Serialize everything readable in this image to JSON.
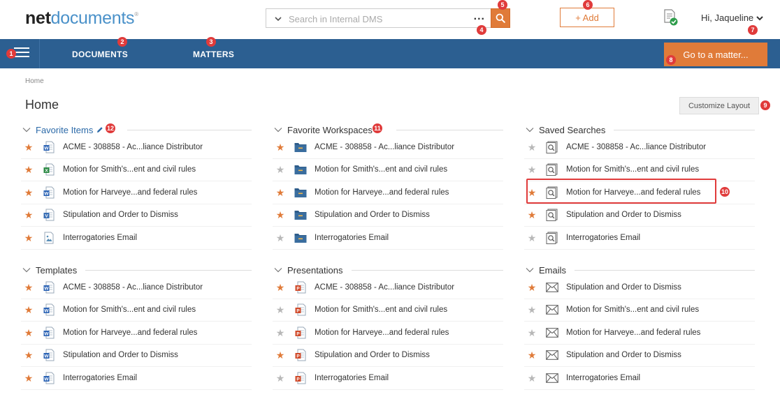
{
  "app": {
    "logo_main": "net",
    "logo_accent": "documents",
    "logo_mark": "®"
  },
  "header": {
    "search_placeholder": "Search in Internal DMS",
    "search_more": "...",
    "add_label": "+ Add",
    "user_label": "Hi, Jaqueline"
  },
  "nav": {
    "tabs": [
      {
        "label": "DOCUMENTS"
      },
      {
        "label": "MATTERS"
      }
    ],
    "goto_label": "Go to a matter..."
  },
  "breadcrumb": "Home",
  "page_title": "Home",
  "customize_label": "Customize Layout",
  "panels": {
    "favorite_items": {
      "title": "Favorite Items",
      "items": [
        {
          "label": "ACME - 308858 - Ac...liance Distributor",
          "starred": true,
          "icon": "word-doc-icon"
        },
        {
          "label": "Motion for Smith's...ent and civil rules",
          "starred": true,
          "icon": "excel-doc-icon"
        },
        {
          "label": "Motion for Harveye...and federal rules",
          "starred": true,
          "icon": "word-doc-icon"
        },
        {
          "label": "Stipulation and Order to Dismiss",
          "starred": true,
          "icon": "visio-doc-icon"
        },
        {
          "label": "Interrogatories Email",
          "starred": true,
          "icon": "image-doc-icon"
        }
      ]
    },
    "favorite_workspaces": {
      "title": "Favorite Workspaces",
      "items": [
        {
          "label": "ACME - 308858 - Ac...liance Distributor",
          "starred": true,
          "icon": "folder-icon"
        },
        {
          "label": "Motion for Smith's...ent and civil rules",
          "starred": false,
          "icon": "folder-icon"
        },
        {
          "label": "Motion for Harveye...and federal rules",
          "starred": true,
          "icon": "folder-icon"
        },
        {
          "label": "Stipulation and Order to Dismiss",
          "starred": true,
          "icon": "folder-icon"
        },
        {
          "label": "Interrogatories Email",
          "starred": false,
          "icon": "folder-icon"
        }
      ]
    },
    "saved_searches": {
      "title": "Saved Searches",
      "items": [
        {
          "label": "ACME - 308858 - Ac...liance Distributor",
          "starred": false,
          "icon": "saved-search-icon"
        },
        {
          "label": "Motion for Smith's...ent and civil rules",
          "starred": false,
          "icon": "saved-search-icon"
        },
        {
          "label": "Motion for Harveye...and federal rules",
          "starred": true,
          "icon": "saved-search-icon"
        },
        {
          "label": "Stipulation and Order to Dismiss",
          "starred": true,
          "icon": "saved-search-icon"
        },
        {
          "label": "Interrogatories Email",
          "starred": false,
          "icon": "saved-search-icon"
        }
      ]
    },
    "templates": {
      "title": "Templates",
      "items": [
        {
          "label": "ACME - 308858 - Ac...liance Distributor",
          "starred": true,
          "icon": "word-doc-icon"
        },
        {
          "label": "Motion for Smith's...ent and civil rules",
          "starred": true,
          "icon": "word-doc-icon"
        },
        {
          "label": "Motion for Harveye...and federal rules",
          "starred": true,
          "icon": "word-doc-icon"
        },
        {
          "label": "Stipulation and Order to Dismiss",
          "starred": true,
          "icon": "word-doc-icon"
        },
        {
          "label": "Interrogatories Email",
          "starred": true,
          "icon": "word-doc-icon"
        }
      ]
    },
    "presentations": {
      "title": "Presentations",
      "items": [
        {
          "label": "ACME - 308858 - Ac...liance Distributor",
          "starred": true,
          "icon": "powerpoint-doc-icon"
        },
        {
          "label": "Motion for Smith's...ent and civil rules",
          "starred": false,
          "icon": "powerpoint-doc-icon"
        },
        {
          "label": "Motion for Harveye...and federal rules",
          "starred": false,
          "icon": "powerpoint-doc-icon"
        },
        {
          "label": "Stipulation and Order to Dismiss",
          "starred": true,
          "icon": "powerpoint-doc-icon"
        },
        {
          "label": "Interrogatories Email",
          "starred": false,
          "icon": "powerpoint-doc-icon"
        }
      ]
    },
    "emails": {
      "title": "Emails",
      "items": [
        {
          "label": "Stipulation and Order to Dismiss",
          "starred": true,
          "icon": "envelope-icon"
        },
        {
          "label": "Motion for Smith's...ent and civil rules",
          "starred": false,
          "icon": "envelope-icon"
        },
        {
          "label": "Motion for Harveye...and federal rules",
          "starred": false,
          "icon": "envelope-icon"
        },
        {
          "label": "Stipulation and Order to Dismiss",
          "starred": true,
          "icon": "envelope-icon"
        },
        {
          "label": "Interrogatories Email",
          "starred": false,
          "icon": "envelope-icon"
        }
      ]
    }
  },
  "callouts": [
    "1",
    "2",
    "3",
    "4",
    "5",
    "6",
    "7",
    "8",
    "9",
    "10",
    "11",
    "12"
  ],
  "colors": {
    "accent": "#e07b39",
    "nav": "#2c5f91",
    "link": "#2c6aa8",
    "callout": "#e03b3b"
  }
}
